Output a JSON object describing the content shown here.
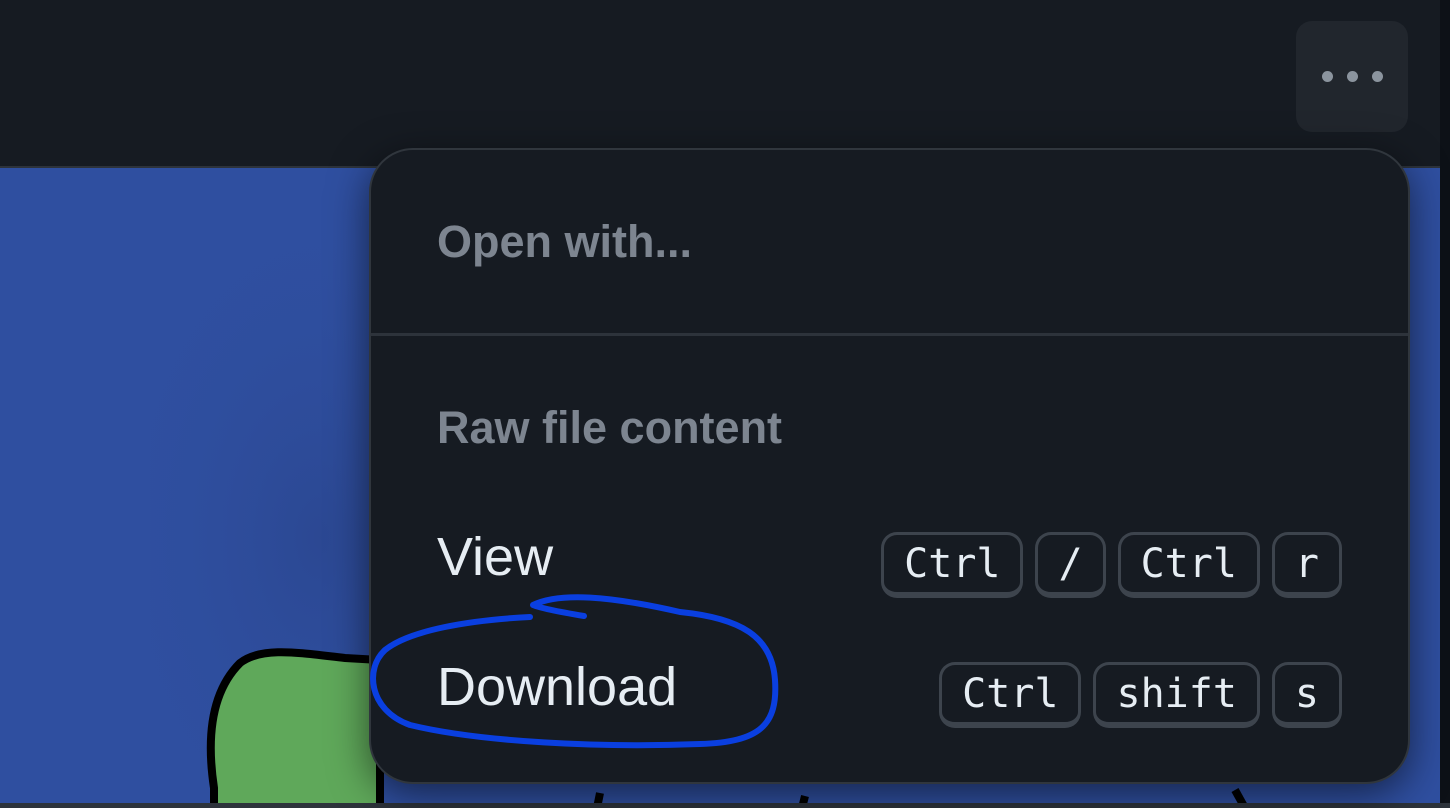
{
  "toolbar": {
    "more_icon": "kebab-horizontal-icon"
  },
  "menu": {
    "open_with_heading": "Open with...",
    "raw_heading": "Raw file content",
    "items": [
      {
        "label": "View",
        "keys": [
          "Ctrl",
          "/",
          "Ctrl",
          "r"
        ]
      },
      {
        "label": "Download",
        "keys": [
          "Ctrl",
          "shift",
          "s"
        ]
      }
    ]
  },
  "colors": {
    "menu_bg": "#161b22",
    "muted_text": "#7d8590",
    "annotation_stroke": "#0a3fe0",
    "preview_bg": "#2f4fa0"
  }
}
